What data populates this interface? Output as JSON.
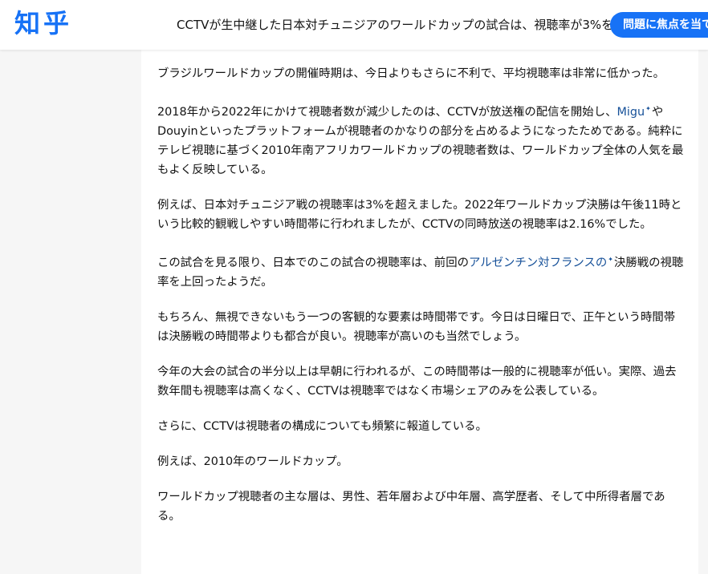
{
  "header": {
    "logo": "知乎",
    "title": "CCTVが生中継した日本対チュニジアのワールドカップの試合は、視聴率が3%を",
    "focus_button": "問題に焦点を当て"
  },
  "article": {
    "p1": "ブラジルワールドカップの開催時期は、今日よりもさらに不利で、平均視聴率は非常に低かった。",
    "p2_before": "2018年から2022年にかけて視聴者数が減少したのは、CCTVが放送権の配信を開始し、",
    "p2_link": "Migu",
    "p2_after": "やDouyinといったプラットフォームが視聴者のかなりの部分を占めるようになったためである。純粋にテレビ視聴に基づく2010年南アフリカワールドカップの視聴者数は、ワールドカップ全体の人気を最もよく反映している。",
    "p3": "例えば、日本対チュニジア戦の視聴率は3%を超えました。2022年ワールドカップ決勝は午後11時という比較的観戦しやすい時間帯に行われましたが、CCTVの同時放送の視聴率は2.16%でした。",
    "p4_before": "この試合を見る限り、日本でのこの試合の視聴率は、前回の",
    "p4_link": "アルゼンチン対フランスの",
    "p4_after": "決勝戦の視聴率を上回ったようだ。",
    "p5": "もちろん、無視できないもう一つの客観的な要素は時間帯です。今日は日曜日で、正午という時間帯は決勝戦の時間帯よりも都合が良い。視聴率が高いのも当然でしょう。",
    "p6": "今年の大会の試合の半分以上は早朝に行われるが、この時間帯は一般的に視聴率が低い。実際、過去数年間も視聴率は高くなく、CCTVは視聴率ではなく市場シェアのみを公表している。",
    "p7": "さらに、CCTVは視聴者の構成についても頻繁に報道している。",
    "p8": "例えば、2010年のワールドカップ。",
    "p9": "ワールドカップ視聴者の主な層は、男性、若年層および中年層、高学歴者、そして中所得者層である。"
  },
  "icons": {
    "link_marker": "spark-icon"
  },
  "colors": {
    "brand": "#1772f6",
    "link": "#175199",
    "text": "#121212",
    "background": "#f6f6f6"
  }
}
